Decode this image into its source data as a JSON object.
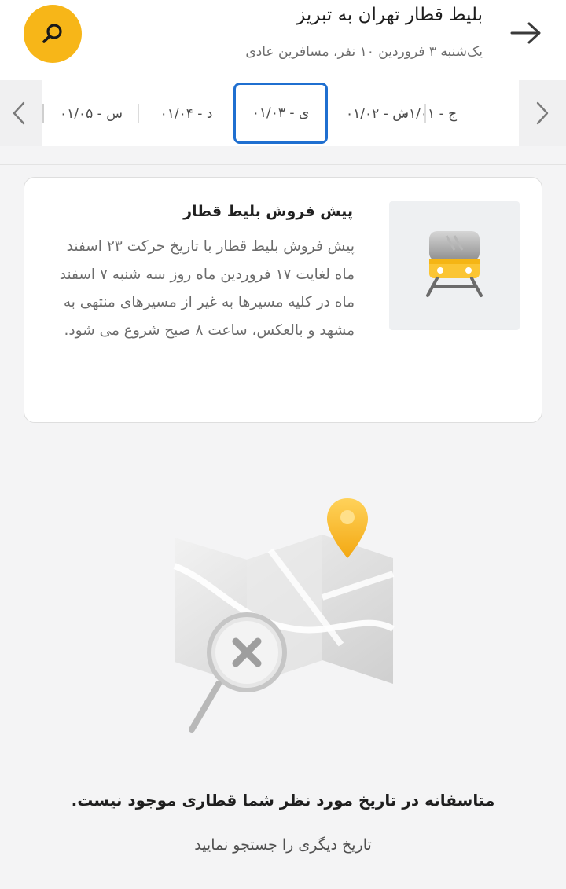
{
  "header": {
    "title": "بلیط قطار تهران به تبریز",
    "subtitle": "یک‌شنبه ۳ فروردین ۱۰ نفر، مسافرین عادی",
    "back_icon": "arrow-right-icon",
    "search_icon": "search-icon",
    "accent_color": "#f7b618"
  },
  "date_bar": {
    "items": [
      {
        "label": "ج - ۰۱/۰۱"
      },
      {
        "label": "ش - ۰۱/۰۲"
      },
      {
        "label": "ی - ۰۱/۰۳",
        "selected": true
      },
      {
        "label": "د - ۰۱/۰۴"
      },
      {
        "label": "س - ۰۱/۰۵"
      }
    ],
    "selected_color": "#1f6fd0"
  },
  "info_card": {
    "title": "پیش فروش بلیط قطار",
    "body": "پیش فروش بلیط قطار با تاریخ حرکت ۲۳ اسفند ماه لغایت ۱۷ فروردین ماه روز سه شنبه ۷ اسفند ماه در کلیه مسیرها به غیر از مسیرهای منتهی به مشهد و بالعکس، ساعت ۸ صبح شروع می شود.",
    "icon": "train-icon"
  },
  "empty_state": {
    "title": "متاسفانه در تاریخ مورد نظر شما قطاری موجود نیست.",
    "subtitle": "تاریخ دیگری را جستجو نمایید",
    "illustration": "map-not-found-icon"
  }
}
